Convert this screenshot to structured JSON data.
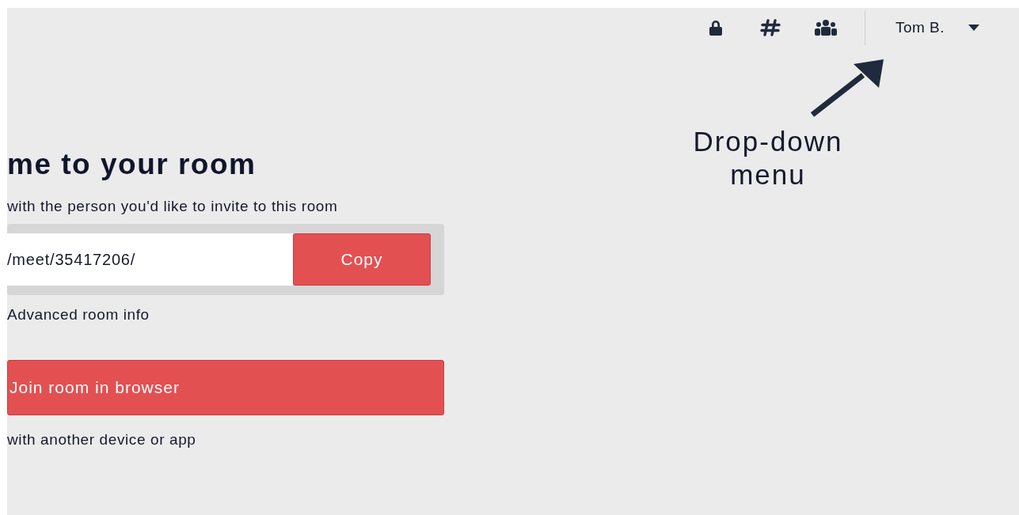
{
  "header": {
    "user_menu": {
      "label": "Tom B."
    }
  },
  "welcome": {
    "heading": "me to your room",
    "instructions": "with the person you'd like to invite to this room",
    "room_link": {
      "value": "/meet/35417206/"
    },
    "copy_button": "Copy",
    "advanced_link": "Advanced room info",
    "join_button": "Join room in browser",
    "other_device_text": "with another device or app"
  },
  "annotation": {
    "text": "Drop-down menu"
  }
}
